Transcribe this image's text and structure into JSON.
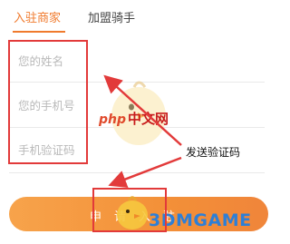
{
  "tabs": [
    {
      "label": "入驻商家",
      "active": true
    },
    {
      "label": "加盟骑手",
      "active": false
    }
  ],
  "form": {
    "name_placeholder": "您的姓名",
    "phone_placeholder": "您的手机号",
    "code_placeholder": "手机验证码",
    "submit_label": "申请入驻"
  },
  "annotation": {
    "send_code": "发送验证码"
  },
  "watermarks": {
    "php": "php",
    "php_cn": "中文网",
    "site": "3DMGAME"
  },
  "colors": {
    "accent": "#f07a2d",
    "annotation_red": "#e23a3a",
    "button_start": "#f7a34b",
    "button_end": "#f0853a"
  }
}
